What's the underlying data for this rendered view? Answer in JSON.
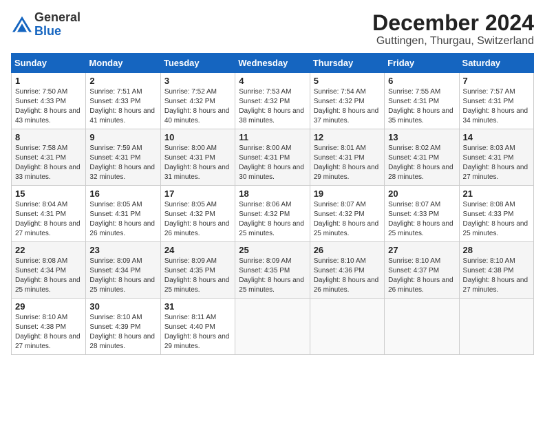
{
  "header": {
    "logo_general": "General",
    "logo_blue": "Blue",
    "title": "December 2024",
    "subtitle": "Guttingen, Thurgau, Switzerland"
  },
  "calendar": {
    "days_of_week": [
      "Sunday",
      "Monday",
      "Tuesday",
      "Wednesday",
      "Thursday",
      "Friday",
      "Saturday"
    ],
    "weeks": [
      [
        {
          "day": "1",
          "sunrise": "7:50 AM",
          "sunset": "4:33 PM",
          "daylight": "8 hours and 43 minutes."
        },
        {
          "day": "2",
          "sunrise": "7:51 AM",
          "sunset": "4:33 PM",
          "daylight": "8 hours and 41 minutes."
        },
        {
          "day": "3",
          "sunrise": "7:52 AM",
          "sunset": "4:32 PM",
          "daylight": "8 hours and 40 minutes."
        },
        {
          "day": "4",
          "sunrise": "7:53 AM",
          "sunset": "4:32 PM",
          "daylight": "8 hours and 38 minutes."
        },
        {
          "day": "5",
          "sunrise": "7:54 AM",
          "sunset": "4:32 PM",
          "daylight": "8 hours and 37 minutes."
        },
        {
          "day": "6",
          "sunrise": "7:55 AM",
          "sunset": "4:31 PM",
          "daylight": "8 hours and 35 minutes."
        },
        {
          "day": "7",
          "sunrise": "7:57 AM",
          "sunset": "4:31 PM",
          "daylight": "8 hours and 34 minutes."
        }
      ],
      [
        {
          "day": "8",
          "sunrise": "7:58 AM",
          "sunset": "4:31 PM",
          "daylight": "8 hours and 33 minutes."
        },
        {
          "day": "9",
          "sunrise": "7:59 AM",
          "sunset": "4:31 PM",
          "daylight": "8 hours and 32 minutes."
        },
        {
          "day": "10",
          "sunrise": "8:00 AM",
          "sunset": "4:31 PM",
          "daylight": "8 hours and 31 minutes."
        },
        {
          "day": "11",
          "sunrise": "8:00 AM",
          "sunset": "4:31 PM",
          "daylight": "8 hours and 30 minutes."
        },
        {
          "day": "12",
          "sunrise": "8:01 AM",
          "sunset": "4:31 PM",
          "daylight": "8 hours and 29 minutes."
        },
        {
          "day": "13",
          "sunrise": "8:02 AM",
          "sunset": "4:31 PM",
          "daylight": "8 hours and 28 minutes."
        },
        {
          "day": "14",
          "sunrise": "8:03 AM",
          "sunset": "4:31 PM",
          "daylight": "8 hours and 27 minutes."
        }
      ],
      [
        {
          "day": "15",
          "sunrise": "8:04 AM",
          "sunset": "4:31 PM",
          "daylight": "8 hours and 27 minutes."
        },
        {
          "day": "16",
          "sunrise": "8:05 AM",
          "sunset": "4:31 PM",
          "daylight": "8 hours and 26 minutes."
        },
        {
          "day": "17",
          "sunrise": "8:05 AM",
          "sunset": "4:32 PM",
          "daylight": "8 hours and 26 minutes."
        },
        {
          "day": "18",
          "sunrise": "8:06 AM",
          "sunset": "4:32 PM",
          "daylight": "8 hours and 25 minutes."
        },
        {
          "day": "19",
          "sunrise": "8:07 AM",
          "sunset": "4:32 PM",
          "daylight": "8 hours and 25 minutes."
        },
        {
          "day": "20",
          "sunrise": "8:07 AM",
          "sunset": "4:33 PM",
          "daylight": "8 hours and 25 minutes."
        },
        {
          "day": "21",
          "sunrise": "8:08 AM",
          "sunset": "4:33 PM",
          "daylight": "8 hours and 25 minutes."
        }
      ],
      [
        {
          "day": "22",
          "sunrise": "8:08 AM",
          "sunset": "4:34 PM",
          "daylight": "8 hours and 25 minutes."
        },
        {
          "day": "23",
          "sunrise": "8:09 AM",
          "sunset": "4:34 PM",
          "daylight": "8 hours and 25 minutes."
        },
        {
          "day": "24",
          "sunrise": "8:09 AM",
          "sunset": "4:35 PM",
          "daylight": "8 hours and 25 minutes."
        },
        {
          "day": "25",
          "sunrise": "8:09 AM",
          "sunset": "4:35 PM",
          "daylight": "8 hours and 25 minutes."
        },
        {
          "day": "26",
          "sunrise": "8:10 AM",
          "sunset": "4:36 PM",
          "daylight": "8 hours and 26 minutes."
        },
        {
          "day": "27",
          "sunrise": "8:10 AM",
          "sunset": "4:37 PM",
          "daylight": "8 hours and 26 minutes."
        },
        {
          "day": "28",
          "sunrise": "8:10 AM",
          "sunset": "4:38 PM",
          "daylight": "8 hours and 27 minutes."
        }
      ],
      [
        {
          "day": "29",
          "sunrise": "8:10 AM",
          "sunset": "4:38 PM",
          "daylight": "8 hours and 27 minutes."
        },
        {
          "day": "30",
          "sunrise": "8:10 AM",
          "sunset": "4:39 PM",
          "daylight": "8 hours and 28 minutes."
        },
        {
          "day": "31",
          "sunrise": "8:11 AM",
          "sunset": "4:40 PM",
          "daylight": "8 hours and 29 minutes."
        },
        null,
        null,
        null,
        null
      ]
    ]
  }
}
